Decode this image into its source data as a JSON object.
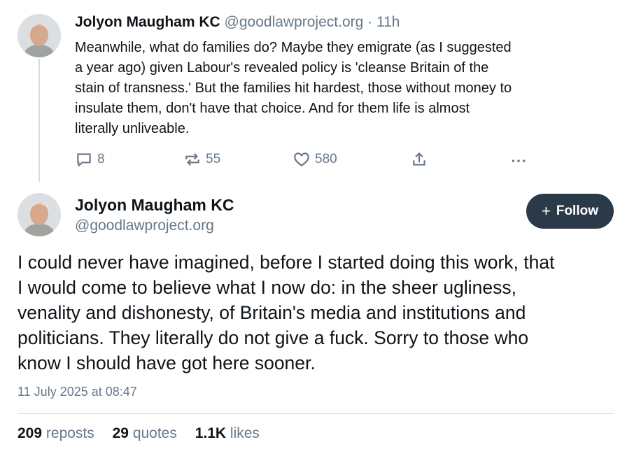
{
  "post1": {
    "author_name": "Jolyon Maugham KC",
    "handle": "@goodlawproject.org",
    "separator": "·",
    "time": "11h",
    "text_lines": [
      "Meanwhile, what do families do? Maybe they emigrate (as I suggested",
      "a year ago) given Labour's revealed policy is 'cleanse Britain of the",
      "stain of transness.' But the families hit hardest, those without money to",
      "insulate them, don't have that choice. And for them life is almost",
      "literally unliveable."
    ],
    "replies": "8",
    "reposts": "55",
    "likes": "580"
  },
  "post2": {
    "author_name": "Jolyon Maugham KC",
    "handle": "@goodlawproject.org",
    "follow_icon": "+",
    "follow_label": "Follow",
    "text_lines": [
      "I could never have imagined, before I started doing this work, that",
      "I would come to believe what I now do: in the sheer ugliness,",
      "venality and dishonesty, of Britain's media and institutions and",
      "politicians. They literally do not give a fuck. Sorry to those who",
      "know I should have got here sooner."
    ],
    "timestamp": "11 July 2025 at 08:47",
    "stats": {
      "reposts_count": "209",
      "reposts_label": "reposts",
      "quotes_count": "29",
      "quotes_label": "quotes",
      "likes_count": "1.1K",
      "likes_label": "likes"
    }
  },
  "icons": [
    "reply-icon",
    "repost-icon",
    "like-icon",
    "share-icon",
    "more-icon"
  ],
  "colors": {
    "muted": "#66788a",
    "text": "#0f1419",
    "follow_bg": "#2b3a49",
    "line": "#d7dde3"
  }
}
